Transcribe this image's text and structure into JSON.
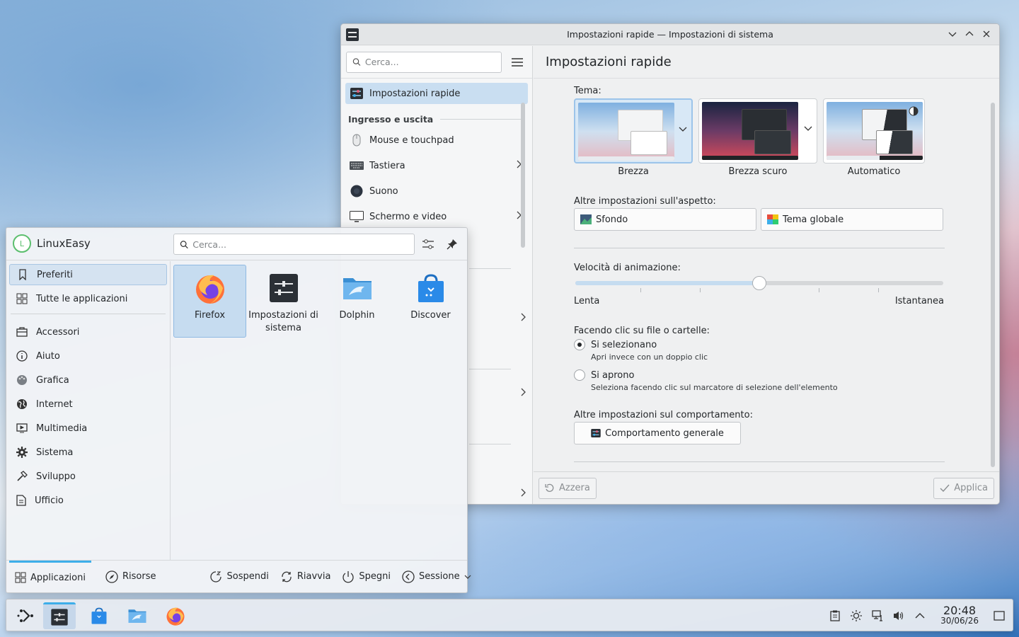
{
  "settings": {
    "window_title": "Impostazioni rapide — Impostazioni di sistema",
    "search_placeholder": "Cerca...",
    "page_title": "Impostazioni rapide",
    "sidebar": {
      "active_item": "Impostazioni rapide",
      "section": "Ingresso e uscita",
      "items": [
        {
          "label": "Mouse e touchpad",
          "icon": "mouse-icon"
        },
        {
          "label": "Tastiera",
          "icon": "keyboard-icon"
        },
        {
          "label": "Suono",
          "icon": "speaker-icon"
        },
        {
          "label": "Schermo e video",
          "icon": "monitor-icon"
        }
      ]
    },
    "theme_label": "Tema:",
    "themes": [
      {
        "name": "Brezza",
        "selected": true
      },
      {
        "name": "Brezza scuro",
        "selected": false
      },
      {
        "name": "Automatico",
        "selected": false
      }
    ],
    "appearance_label": "Altre impostazioni sull'aspetto:",
    "wallpaper_button": "Sfondo",
    "global_theme_button": "Tema globale",
    "animation_label": "Velocità di animazione:",
    "animation_min": "Lenta",
    "animation_max": "Istantanea",
    "animation_value": 0.5,
    "click_label": "Facendo clic su file o cartelle:",
    "click_select": "Si selezionano",
    "click_select_hint": "Apri invece con un doppio clic",
    "click_open": "Si aprono",
    "click_open_hint": "Seleziona facendo clic sul marcatore di selezione dell'elemento",
    "behavior_label": "Altre impostazioni sul comportamento:",
    "behavior_button": "Comportamento generale",
    "reset_button": "Azzera",
    "apply_button": "Applica"
  },
  "launcher": {
    "user_initial": "L",
    "user_name": "LinuxEasy",
    "search_placeholder": "Cerca...",
    "categories_top": [
      {
        "label": "Preferiti",
        "icon": "bookmark-icon"
      },
      {
        "label": "Tutte le applicazioni",
        "icon": "grid-icon"
      }
    ],
    "categories": [
      {
        "label": "Accessori",
        "icon": "briefcase-icon"
      },
      {
        "label": "Aiuto",
        "icon": "info-icon"
      },
      {
        "label": "Grafica",
        "icon": "palette-icon"
      },
      {
        "label": "Internet",
        "icon": "globe-icon"
      },
      {
        "label": "Multimedia",
        "icon": "film-icon"
      },
      {
        "label": "Sistema",
        "icon": "gear-icon"
      },
      {
        "label": "Sviluppo",
        "icon": "hammer-icon"
      },
      {
        "label": "Ufficio",
        "icon": "document-icon"
      }
    ],
    "apps": [
      {
        "label": "Firefox"
      },
      {
        "label": "Impostazioni di sistema"
      },
      {
        "label": "Dolphin"
      },
      {
        "label": "Discover"
      }
    ],
    "footer": {
      "applications": "Applicazioni",
      "places": "Risorse",
      "sleep": "Sospendi",
      "restart": "Riavvia",
      "shutdown": "Spegni",
      "session": "Sessione"
    }
  },
  "taskbar": {
    "time": "20:48",
    "date": "30/06/26"
  },
  "colors": {
    "accent": "#3daee9",
    "selection": "#c9def1"
  }
}
